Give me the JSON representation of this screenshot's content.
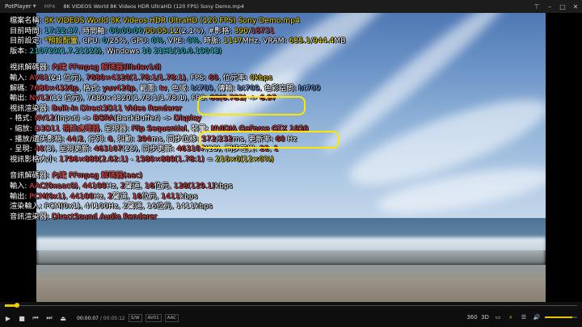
{
  "titlebar": {
    "app": "PotPlayer",
    "format": "MP4",
    "title": "8K VIDEOS   World 8K Videos HDR UltraHD  (120 FPS)   Sony Demo.mp4"
  },
  "osd": {
    "file": {
      "label": "檔案名稱: ",
      "value": "8K VIDEOS   World 8K Videos HDR UltraHD   (120 FPS)   Sony Demo.mp4"
    },
    "time": {
      "label": "目前時間: ",
      "clock": "17:22:37",
      "t1": ", 時間軸: ",
      "pos": "00:00:06",
      "sep": "/",
      "dur": "00:05:12",
      "pct": "(2.1%)",
      "t2": ", #影格: ",
      "frame": "390",
      "fsep": "/",
      "frames": "18731"
    },
    "settings": {
      "label": "目前設定: ",
      "preset": "*預設配置",
      "cpu_l": ", CPU: ",
      "cpu": "0",
      "cpu_r": "/25%, GPU: ",
      "gpu": "0%",
      "vpe_l": ", VPE: ",
      "vpe": "0%",
      "clk_l": ", 時脈: ",
      "clk": "1147",
      "clk_r": "MHz, VRAM: ",
      "vram": "635.1",
      "vsep": "/",
      "vtot": "944.4",
      "vunit": "MB"
    },
    "version": {
      "label": "版本: ",
      "v": "210729",
      "vb": "(1.7.21525)",
      "os": ", Windows ",
      "w": "10 21H1",
      "wb": "(10.0.19043)"
    },
    "vdec": {
      "label": "視訊解碼器: ",
      "name": "內建 FFmpeg 解碼器(libdav1d)"
    },
    "vin": {
      "label": "輸入: ",
      "codec": "AV01",
      "bits": "(24 位元)",
      "c": ", ",
      "res": "7680×4320",
      "ar": "(1.78:1/1.78:1)",
      "fps_l": ", FPS: ",
      "fps": "60",
      "br_l": ", 位元率: ",
      "br": "0kbps"
    },
    "vdecode": {
      "label": "解碼: ",
      "res": "7680×4320p",
      "fmt_l": ", 格式: ",
      "fmt": "yuv420p",
      "range_l": ", 範圍: ",
      "range": "tv",
      "cs_l": ", 色域: ",
      "cs": "bt709",
      "tr_l": ", 傳輸: ",
      "tr": "bt709",
      "sp_l": ", 色彩空間: ",
      "sp": "bt709"
    },
    "vout": {
      "label": "輸出: ",
      "fmt": "NV12",
      "bits": "(12 位元)",
      "rest": ", 7680×4320(1.78:1/1.78:1), FPS: ",
      "fps": "60",
      "fps2": "(6.783)",
      "arrow": " -> ",
      "fps3": "6.97"
    },
    "vrend": {
      "label": "視訊渲染器: ",
      "name": "Built-in Direct3D11 Video Renderer"
    },
    "vfmt": {
      "label": " - 格式: ",
      "a": "NV12",
      "ai": "(Input)",
      "arrow": " -> ",
      "b": "BGRA",
      "bi": "(BackBuffer)",
      "arrow2": " -> ",
      "c": "Display"
    },
    "vscale": {
      "label": " - 縮放: ",
      "scaler": "D3D11 視訊處理器",
      "pres_l": ", 呈現器: ",
      "pres": "Flip Sequential",
      "dev_l": ", 裝置: ",
      "dev": "NVIDIA GeForce GTX 1050"
    },
    "vplay": {
      "label": " - 播放/遺失影格: ",
      "played": "44",
      "psep": "/",
      "lost": "2",
      "q_l": ", 佇列: ",
      "q": "0",
      "j_l": ", 抖動: ",
      "j": "394",
      "j_r": "ms, 同步位移: ",
      "sync": "572",
      "s_sep": "/",
      "sync2": "232",
      "s_r": "ms, 更新率: ",
      "hz": "60",
      "hz_u": " Hz"
    },
    "vpres": {
      "label": " - 呈現: ",
      "p": "40",
      "pb": "(3)",
      "t_l": ", 呈現更新: ",
      "t": "463107",
      "tb": "(25)",
      "s_l": ", 同步更新: ",
      "s": "463107",
      "sb": "(25)",
      "d_l": ", 同步差異: ",
      "d": "22",
      "dsep": ", ",
      "d2": "1"
    },
    "vsize": {
      "label": "視訊影格大小: ",
      "a": "1796×889",
      "ab": "(2.02:1)",
      "arrow": " - ",
      "b": "1580×889",
      "bb": "(1.78:1)",
      "eq": " = ",
      "c": "216×0",
      "cb": "(12×0%)"
    },
    "adec": {
      "label": "音訊解碼器: ",
      "name": "內建 FFmpeg 解碼器(aac)"
    },
    "ain": {
      "label": "輸入: ",
      "codec": "AAC",
      "code": "(0xaac0)",
      "c": ", ",
      "hz": "44100",
      "hz_r": "Hz, ",
      "ch": "2",
      "ch_r": "聲道, ",
      "bits": "16",
      "b_r": "位元, ",
      "br": "128",
      "brb": "(129.1)",
      "br_u": "kbps"
    },
    "aout": {
      "label": "輸出: ",
      "codec": "PCM",
      "code": "(0x1)",
      "c": ", ",
      "hz": "44100",
      "hz_r": "Hz, ",
      "ch": "2",
      "ch_r": "聲道, ",
      "bits": "16",
      "b_r": "位元, ",
      "br": "1411",
      "br_u": "kbps"
    },
    "arin": {
      "label": "渲染輸入: ",
      "text": "PCM(0x1), 44100Hz, 2聲道, 16位元, 1411kbps"
    },
    "arend": {
      "label": "音訊渲染器: ",
      "name": "DirectSound Audio Renderer"
    }
  },
  "controls": {
    "time_cur": "00:00:07",
    "time_sep": " / ",
    "time_dur": "00:05:12",
    "tag1": "S/W",
    "tag2": "AV01",
    "tag3": "AAC",
    "r1": "360",
    "r2": "3D",
    "progress": 0.021,
    "volume": 0.85
  },
  "colors": {
    "accent": "#ffe200",
    "highlight": "#ff4a4a",
    "teal": "#27e6d6"
  }
}
